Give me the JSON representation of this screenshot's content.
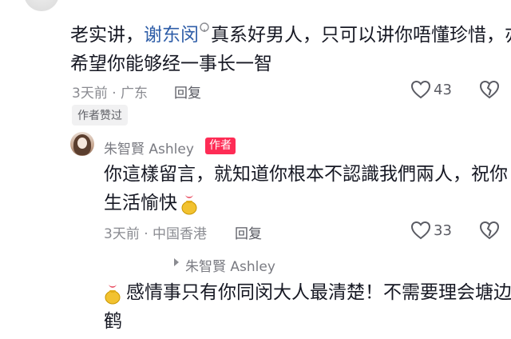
{
  "comment1": {
    "text_prefix": "老实讲，",
    "mention": "谢东闵",
    "text_suffix": "真系好男人，只可以讲你唔懂珍惜，亦",
    "line2": "希望你能够经一事长一智",
    "meta": "3天前 · 广东",
    "reply_label": "回复",
    "likes": "43",
    "chip": "作者赞过"
  },
  "reply1": {
    "author": "朱智賢 Ashley",
    "badge": "作者",
    "line1": "你這樣留言，就知道你根本不認識我們兩人，祝你",
    "line2": "生活愉快",
    "meta": "3天前 · 中国香港",
    "reply_label": "回复",
    "likes": "33"
  },
  "reply2": {
    "reply_to": "朱智賢 Ashley",
    "line1": "感情事只有你同闵大人最清楚！不需要理会塘边",
    "line2": "鹤"
  },
  "colors": {
    "mention": "#2f5ea8",
    "badge": "#fe2c55",
    "meta": "#8a8b91"
  },
  "icons": [
    "heart-outline-icon",
    "broken-heart-icon",
    "gold-bag-emoji-icon",
    "verified-check-icon",
    "reply-arrow-icon"
  ]
}
